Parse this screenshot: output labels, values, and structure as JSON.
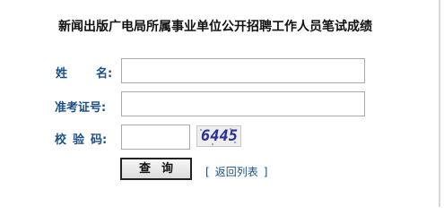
{
  "page": {
    "title": "新闻出版广电局所属事业单位公开招聘工作人员笔试成绩"
  },
  "form": {
    "name_label": [
      "姓",
      "名:"
    ],
    "exam_number_label": "准考证号:",
    "captcha_label": [
      "校",
      "验",
      "码:"
    ],
    "name_value": "",
    "exam_number_value": "",
    "captcha_value": "",
    "captcha_image_text": "6445",
    "submit_label": "查询",
    "back_link": {
      "open_bracket": "[",
      "text": "返回列表",
      "close_bracket": "]"
    }
  }
}
